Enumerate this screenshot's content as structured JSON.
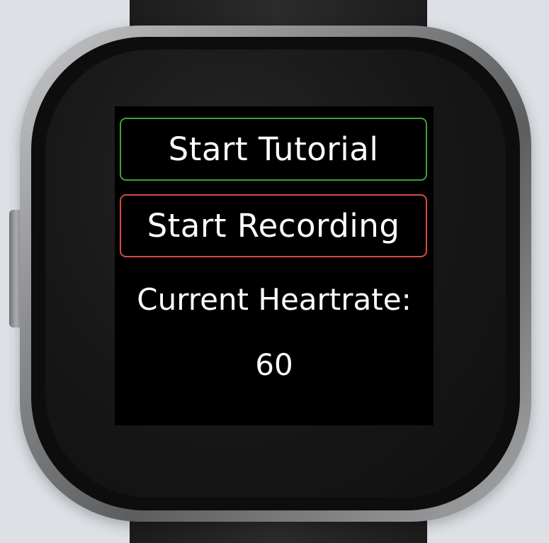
{
  "buttons": {
    "tutorial_label": "Start Tutorial",
    "recording_label": "Start Recording"
  },
  "heartrate": {
    "label": "Current Heartrate:",
    "value": "60"
  },
  "colors": {
    "tutorial_border": "#3f9f3f",
    "recording_border": "#d94a44",
    "screen_background": "#000000",
    "text": "#ffffff"
  }
}
